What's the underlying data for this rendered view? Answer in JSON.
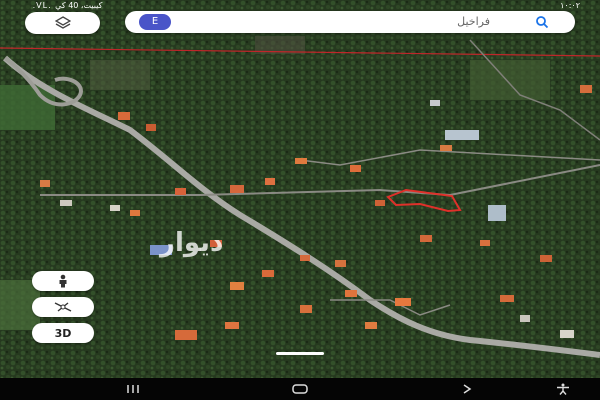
{
  "status_bar": {
    "left_text": " .VL. كيبيت، 40 كي",
    "time": "۱۰:۰۲"
  },
  "layers_button": {
    "icon": "layers-icon"
  },
  "search": {
    "avatar_letter": "E",
    "query": "فراخیل",
    "icon": "search-icon"
  },
  "side_buttons": {
    "street_view_icon": "pegman-icon",
    "compass_icon": "compass-icon",
    "view_3d_label": "3D"
  },
  "watermark_text": "دیوار",
  "nav_bar": {
    "recent_icon": "recent-apps-icon",
    "home_icon": "home-icon",
    "back_icon": "back-icon",
    "assist_icon": "accessibility-icon"
  },
  "colors": {
    "satellite_base": "#263a22",
    "road": "#a9a9a4",
    "boundary_line": "#c0262a",
    "parcel_outline": "#e0302a",
    "avatar": "#4a55c8"
  }
}
